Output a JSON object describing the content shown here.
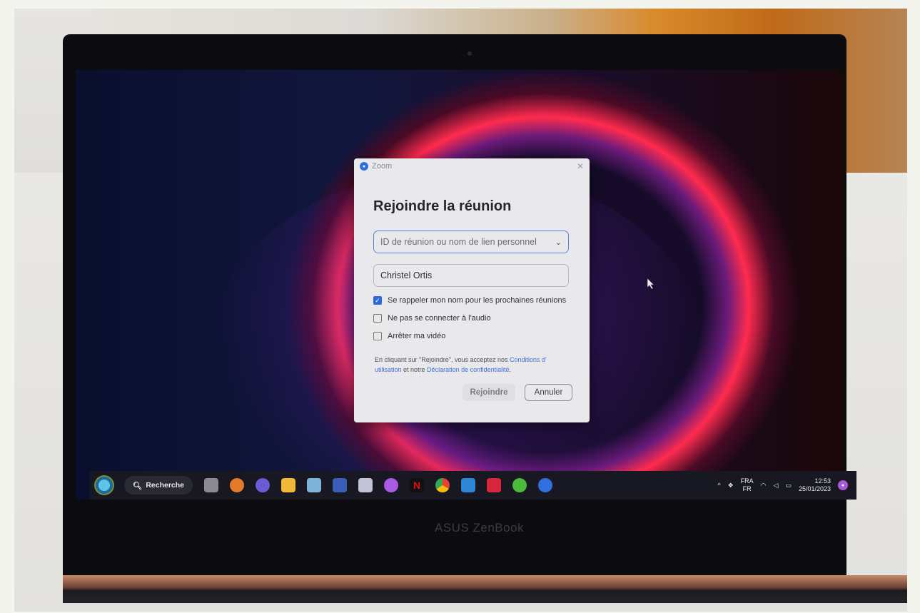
{
  "dialog": {
    "app_name": "Zoom",
    "title": "Rejoindre la réunion",
    "meeting_id_placeholder": "ID de réunion ou nom de lien personnel",
    "name_value": "Christel Ortis",
    "options": [
      {
        "label": "Se rappeler mon nom pour les prochaines réunions",
        "checked": true
      },
      {
        "label": "Ne pas se connecter à l'audio",
        "checked": false
      },
      {
        "label": "Arrêter ma vidéo",
        "checked": false
      }
    ],
    "legal_prefix": "En cliquant sur \"Rejoindre\", vous acceptez nos ",
    "legal_terms_link": "Conditions d' utilisation",
    "legal_middle": " et notre ",
    "legal_privacy_link": "Déclaration de confidentialité",
    "legal_suffix": ".",
    "join_label": "Rejoindre",
    "cancel_label": "Annuler",
    "accent_color": "#2e6ad9"
  },
  "taskbar": {
    "search_label": "Recherche",
    "language_top": "FRA",
    "language_bottom": "FR",
    "time": "12:53",
    "date": "25/01/2023",
    "pinned_icons": [
      "files-icon",
      "teams-icon",
      "camera-icon",
      "folder-icon",
      "photos-icon",
      "app-icon",
      "paint-icon",
      "messenger-icon",
      "netflix-icon",
      "chrome-icon",
      "store-icon",
      "tool-icon",
      "clover-icon",
      "zoom-icon"
    ]
  },
  "laptop": {
    "brand": "ASUS ZenBook"
  }
}
